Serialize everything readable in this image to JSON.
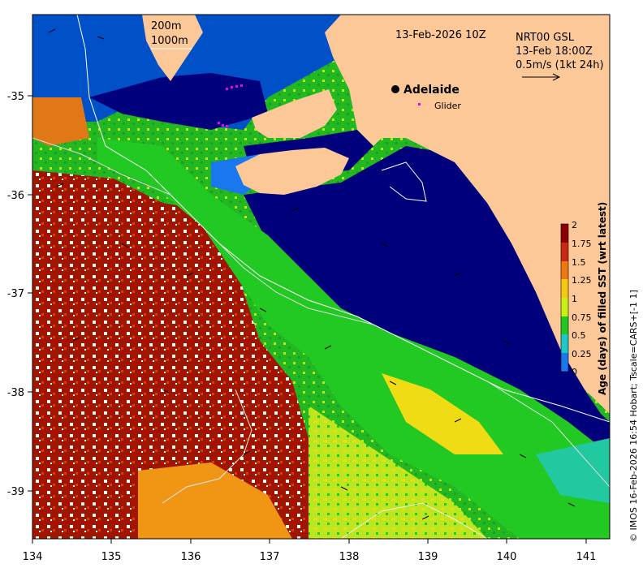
{
  "map": {
    "header_date": "13-Feb-2026 10Z",
    "product": "NRT00 GSL",
    "valid_time": "13-Feb 18:00Z",
    "vector_scale": "0.5m/s (1kt 24h)",
    "depth_contours": [
      "200m",
      "1000m"
    ],
    "city": "Adelaide",
    "glider_label": "Glider",
    "credit": "© IMOS 16-Feb-2026 16:54 Hobart; Tscale=CARS+[-1 1]",
    "x_ticks": [
      "134",
      "135",
      "136",
      "137",
      "138",
      "139",
      "140",
      "141"
    ],
    "y_ticks": [
      "-35",
      "-36",
      "-37",
      "-38",
      "-39"
    ],
    "colors": {
      "land": "#fcc898",
      "age_0": "#00007d",
      "age_0_25": "#0055cc",
      "age_0_5": "#1ea0e6",
      "age_0_75": "#22c8b4",
      "age_1": "#22c922",
      "age_1_25": "#bce61e",
      "age_1_5": "#f0dc14",
      "age_1_75": "#f09614",
      "age_2": "#a01400",
      "missing": "#ffffff",
      "glider": "#ee00ee"
    }
  },
  "colorbar": {
    "title": "Age (days) of filled SST (wrt latest)",
    "labels": [
      "2",
      "1.75",
      "1.5",
      "1.25",
      "1",
      "0.75",
      "0.5",
      "0.25",
      "0"
    ],
    "colors": [
      "#8b0000",
      "#c82814",
      "#f07814",
      "#f5c814",
      "#c8f014",
      "#22c922",
      "#1ec8c8",
      "#1a78ee",
      "#00008b"
    ]
  }
}
